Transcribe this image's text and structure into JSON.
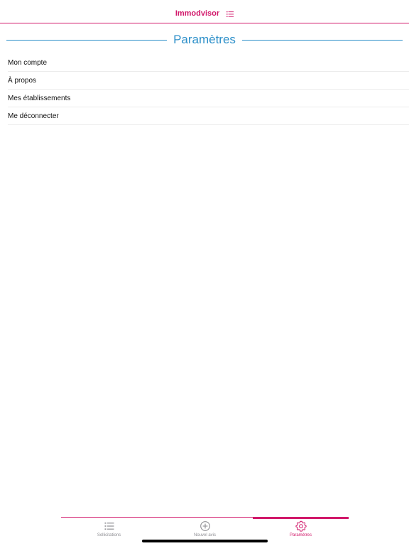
{
  "navbar": {
    "title": "Immodvisor",
    "menu_icon": "list-icon"
  },
  "section": {
    "title": "Paramètres"
  },
  "settings": {
    "items": [
      {
        "label": "Mon compte"
      },
      {
        "label": "À propos"
      },
      {
        "label": "Mes établissements"
      },
      {
        "label": "Me déconnecter"
      }
    ]
  },
  "tabbar": {
    "tabs": [
      {
        "label": "Sollicitations",
        "icon": "list-icon"
      },
      {
        "label": "Nouvel avis",
        "icon": "plus-circle-icon"
      },
      {
        "label": "Paramètres",
        "icon": "gear-icon"
      }
    ],
    "active_tab": "Paramètres"
  },
  "colors": {
    "brand": "#d1186a",
    "section_title": "#2c8fc9",
    "inactive_tab": "#8e8e93"
  }
}
